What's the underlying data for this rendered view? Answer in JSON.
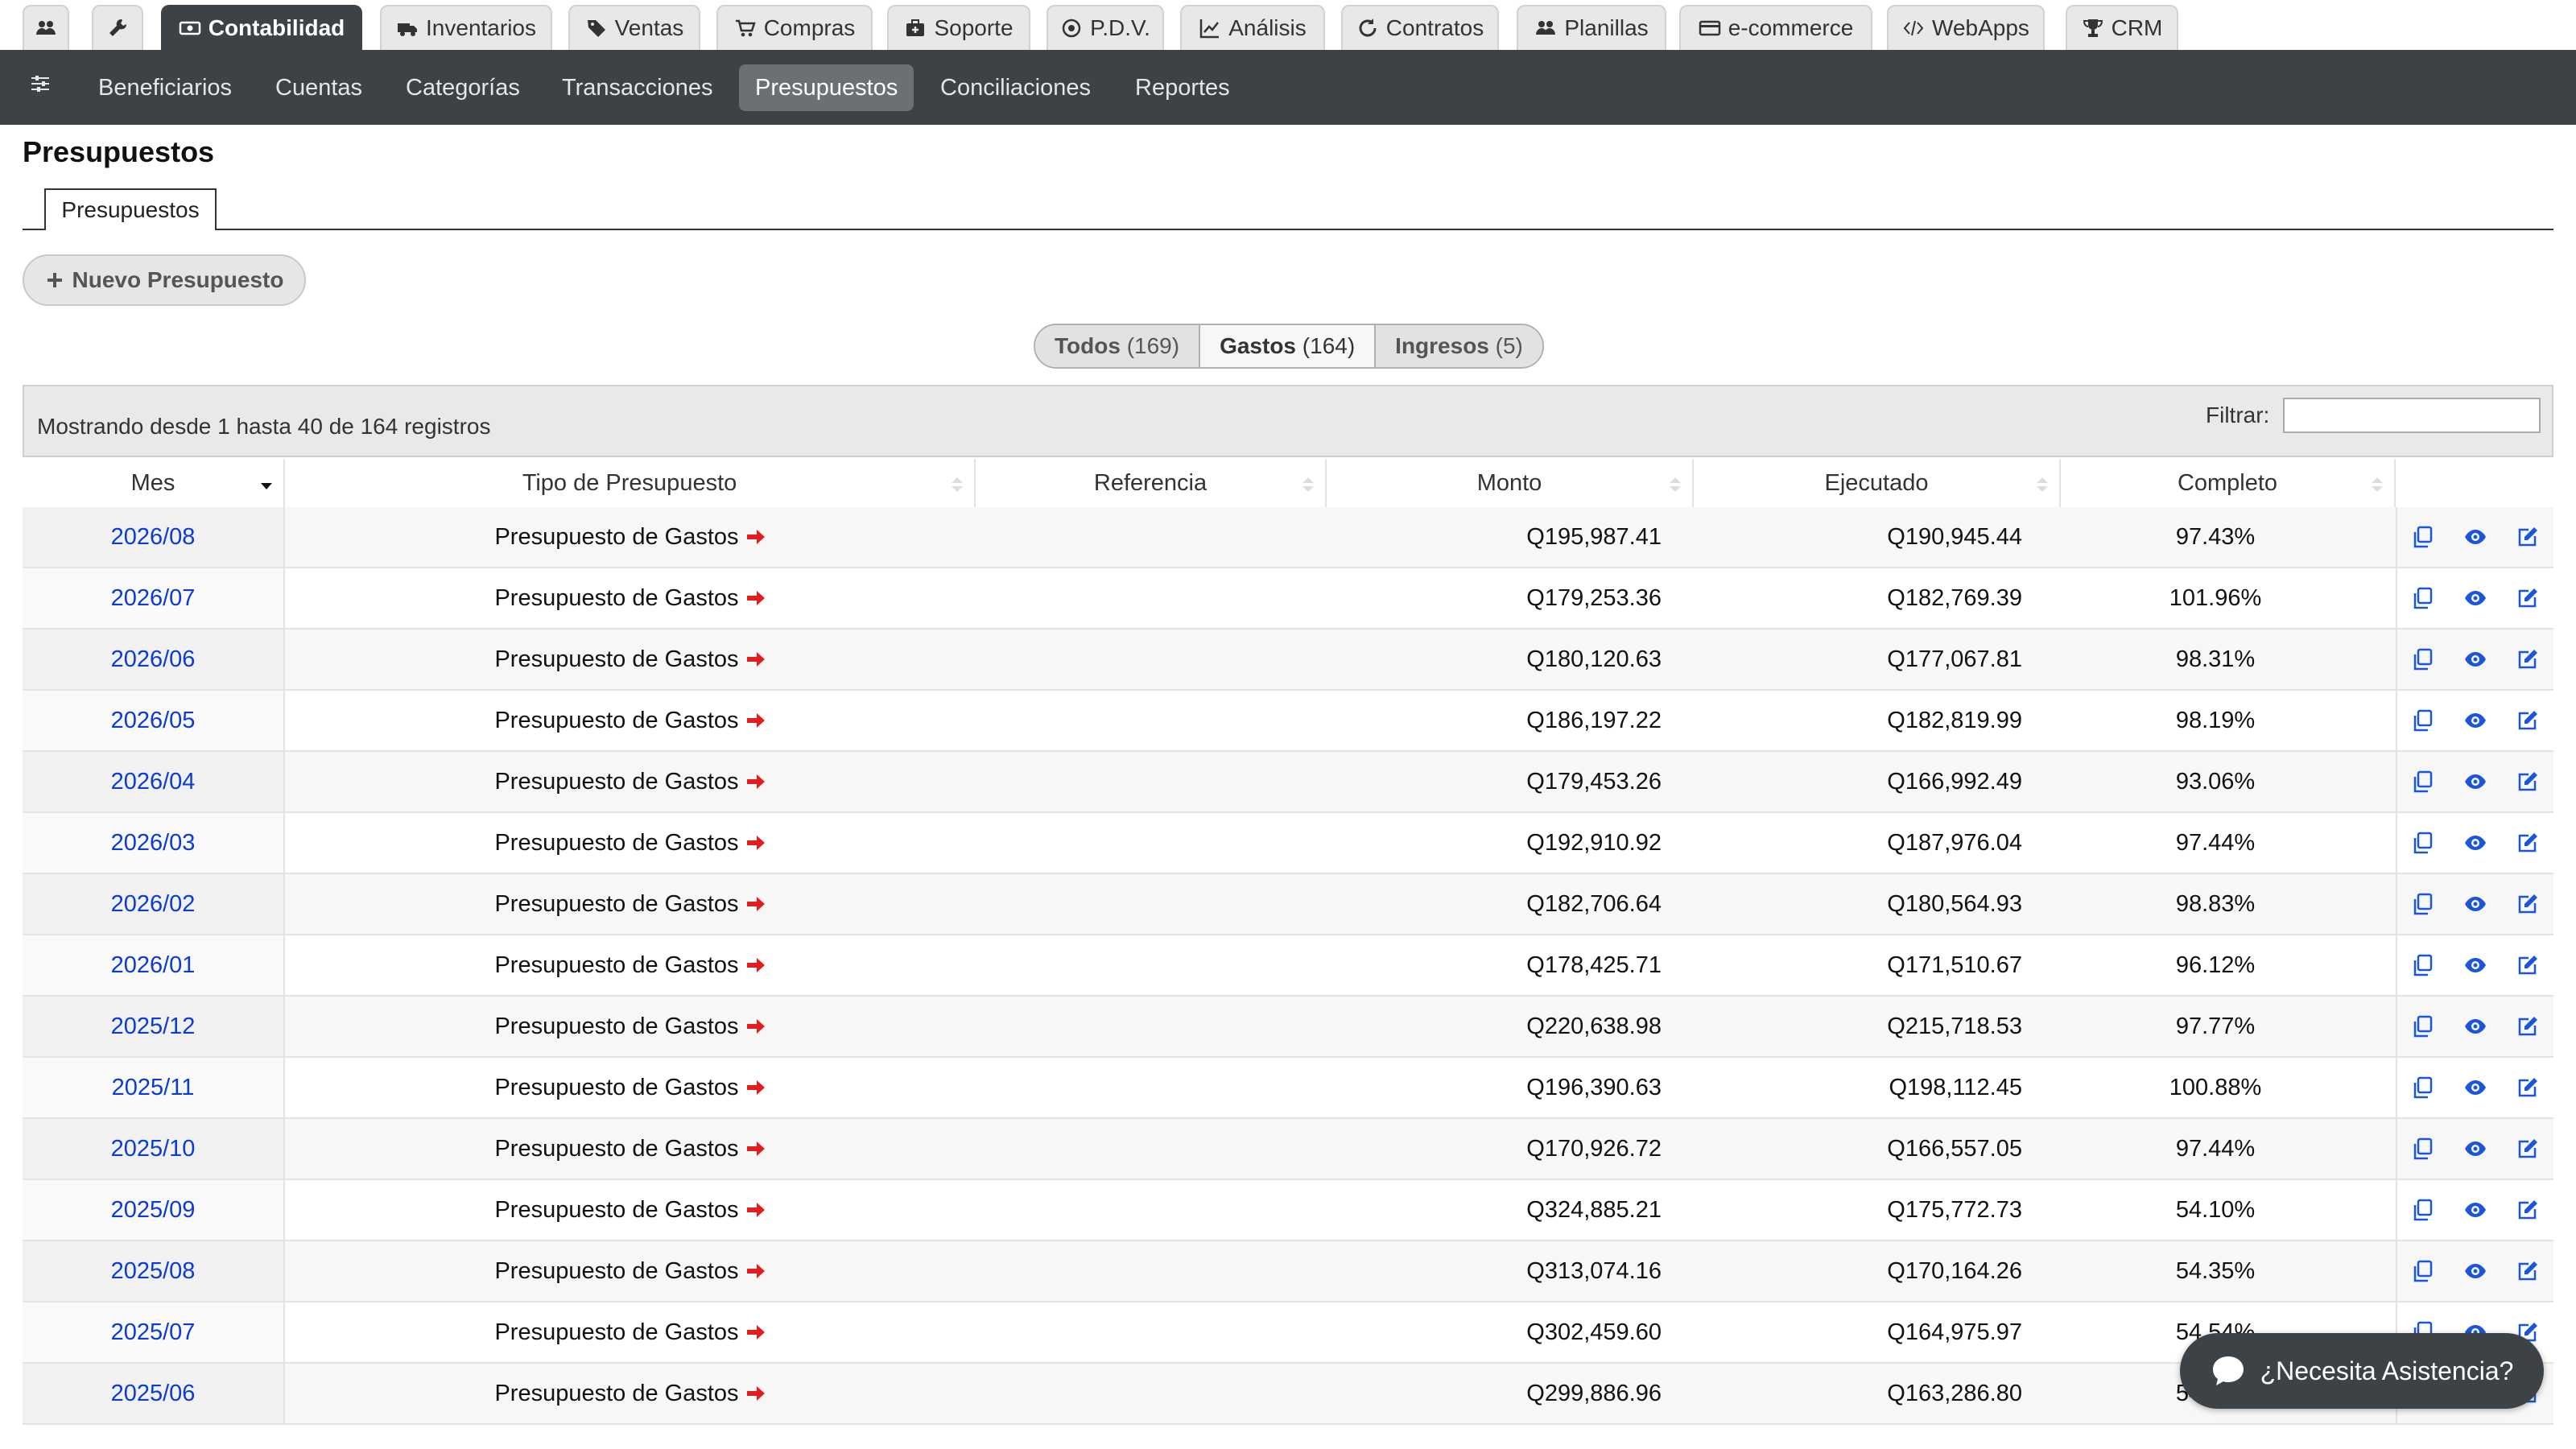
{
  "top_tabs": [
    {
      "label": "",
      "icon": "users-icon"
    },
    {
      "label": "",
      "icon": "wrench-icon"
    },
    {
      "label": "Contabilidad",
      "icon": "money-icon",
      "active": true
    },
    {
      "label": "Inventarios",
      "icon": "truck-icon"
    },
    {
      "label": "Ventas",
      "icon": "tag-icon"
    },
    {
      "label": "Compras",
      "icon": "cart-icon"
    },
    {
      "label": "Soporte",
      "icon": "medkit-icon"
    },
    {
      "label": "P.D.V.",
      "icon": "target-icon"
    },
    {
      "label": "Análisis",
      "icon": "chart-line-icon"
    },
    {
      "label": "Contratos",
      "icon": "refresh-icon"
    },
    {
      "label": "Planillas",
      "icon": "users-icon"
    },
    {
      "label": "e-commerce",
      "icon": "credit-card-icon"
    },
    {
      "label": "WebApps",
      "icon": "code-icon"
    },
    {
      "label": "CRM",
      "icon": "trophy-icon"
    }
  ],
  "sub_nav": {
    "icon": "sliders-icon",
    "items": [
      "Beneficiarios",
      "Cuentas",
      "Categorías",
      "Transacciones",
      "Presupuestos",
      "Conciliaciones",
      "Reportes"
    ],
    "active": "Presupuestos"
  },
  "page": {
    "title": "Presupuestos",
    "tab_label": "Presupuestos",
    "new_button": "Nuevo Presupuesto"
  },
  "filters": [
    {
      "label": "Todos",
      "count": "(169)"
    },
    {
      "label": "Gastos",
      "count": "(164)",
      "active": true
    },
    {
      "label": "Ingresos",
      "count": "(5)"
    }
  ],
  "table_info": {
    "showing": "Mostrando desde 1 hasta 40 de 164 registros",
    "filter_label": "Filtrar:",
    "filter_value": ""
  },
  "columns": [
    "Mes",
    "Tipo de Presupuesto",
    "Referencia",
    "Monto",
    "Ejecutado",
    "Completo"
  ],
  "rows": [
    {
      "mes": "2026/08",
      "tipo": "Presupuesto de Gastos",
      "referencia": "",
      "monto": "Q195,987.41",
      "ejecutado": "Q190,945.44",
      "completo": "97.43%"
    },
    {
      "mes": "2026/07",
      "tipo": "Presupuesto de Gastos",
      "referencia": "",
      "monto": "Q179,253.36",
      "ejecutado": "Q182,769.39",
      "completo": "101.96%"
    },
    {
      "mes": "2026/06",
      "tipo": "Presupuesto de Gastos",
      "referencia": "",
      "monto": "Q180,120.63",
      "ejecutado": "Q177,067.81",
      "completo": "98.31%"
    },
    {
      "mes": "2026/05",
      "tipo": "Presupuesto de Gastos",
      "referencia": "",
      "monto": "Q186,197.22",
      "ejecutado": "Q182,819.99",
      "completo": "98.19%"
    },
    {
      "mes": "2026/04",
      "tipo": "Presupuesto de Gastos",
      "referencia": "",
      "monto": "Q179,453.26",
      "ejecutado": "Q166,992.49",
      "completo": "93.06%"
    },
    {
      "mes": "2026/03",
      "tipo": "Presupuesto de Gastos",
      "referencia": "",
      "monto": "Q192,910.92",
      "ejecutado": "Q187,976.04",
      "completo": "97.44%"
    },
    {
      "mes": "2026/02",
      "tipo": "Presupuesto de Gastos",
      "referencia": "",
      "monto": "Q182,706.64",
      "ejecutado": "Q180,564.93",
      "completo": "98.83%"
    },
    {
      "mes": "2026/01",
      "tipo": "Presupuesto de Gastos",
      "referencia": "",
      "monto": "Q178,425.71",
      "ejecutado": "Q171,510.67",
      "completo": "96.12%"
    },
    {
      "mes": "2025/12",
      "tipo": "Presupuesto de Gastos",
      "referencia": "",
      "monto": "Q220,638.98",
      "ejecutado": "Q215,718.53",
      "completo": "97.77%"
    },
    {
      "mes": "2025/11",
      "tipo": "Presupuesto de Gastos",
      "referencia": "",
      "monto": "Q196,390.63",
      "ejecutado": "Q198,112.45",
      "completo": "100.88%"
    },
    {
      "mes": "2025/10",
      "tipo": "Presupuesto de Gastos",
      "referencia": "",
      "monto": "Q170,926.72",
      "ejecutado": "Q166,557.05",
      "completo": "97.44%"
    },
    {
      "mes": "2025/09",
      "tipo": "Presupuesto de Gastos",
      "referencia": "",
      "monto": "Q324,885.21",
      "ejecutado": "Q175,772.73",
      "completo": "54.10%"
    },
    {
      "mes": "2025/08",
      "tipo": "Presupuesto de Gastos",
      "referencia": "",
      "monto": "Q313,074.16",
      "ejecutado": "Q170,164.26",
      "completo": "54.35%"
    },
    {
      "mes": "2025/07",
      "tipo": "Presupuesto de Gastos",
      "referencia": "",
      "monto": "Q302,459.60",
      "ejecutado": "Q164,975.97",
      "completo": "54.54%"
    },
    {
      "mes": "2025/06",
      "tipo": "Presupuesto de Gastos",
      "referencia": "",
      "monto": "Q299,886.96",
      "ejecutado": "Q163,286.80",
      "completo": "54.__%"
    }
  ],
  "row_actions": [
    "copy-icon",
    "eye-icon",
    "edit-icon"
  ],
  "help_button": {
    "label": "¿Necesita Asistencia?",
    "icon": "chat-bubble-icon"
  },
  "colors": {
    "dark_bar": "#3d4247",
    "link": "#0b3bd6",
    "arrow": "#e11d1d"
  }
}
